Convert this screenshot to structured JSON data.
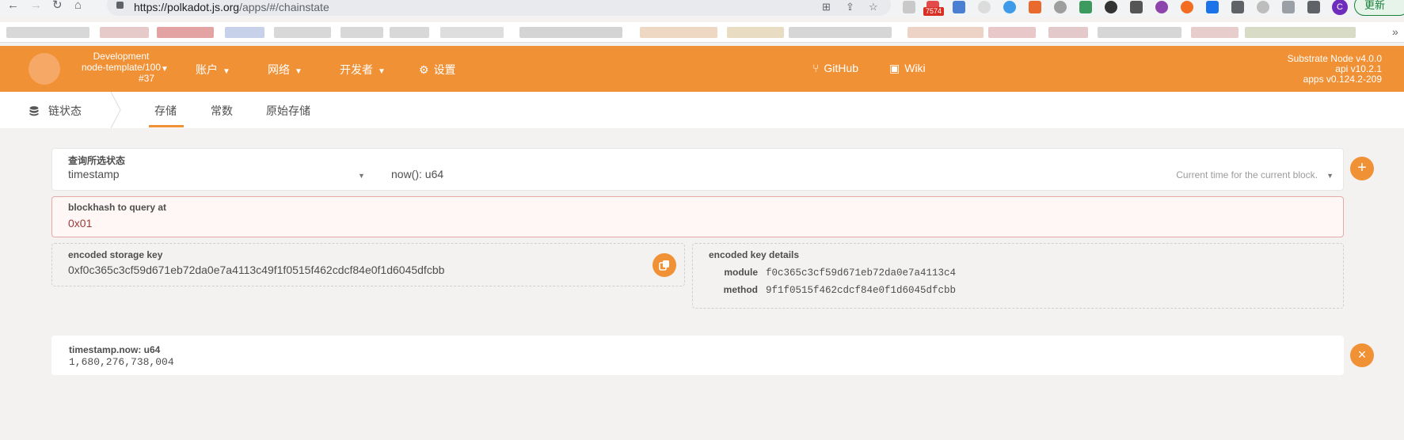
{
  "browser": {
    "url_host": "polkadot.js.org",
    "url_path": "/apps/#/chainstate",
    "mail_badge": "7574",
    "avatar_letter": "C",
    "update_label": "更新"
  },
  "chain": {
    "name": "Development",
    "runtime": "node-template/100",
    "block": "#37"
  },
  "menu": {
    "accounts": "账户",
    "network": "网络",
    "developer": "开发者",
    "settings": "设置"
  },
  "links": {
    "github": "GitHub",
    "wiki": "Wiki"
  },
  "node": {
    "name": "Substrate Node v4.0.0",
    "api": "api v10.2.1",
    "apps": "apps v0.124.2-209"
  },
  "page": {
    "section_title": "链状态",
    "tabs": [
      "存储",
      "常数",
      "原始存储"
    ]
  },
  "query": {
    "label": "查询所选状态",
    "module": "timestamp",
    "method": "now(): u64",
    "method_hint": "Current time for the current block."
  },
  "blockhash": {
    "label": "blockhash to query at",
    "value": "0x01"
  },
  "storage_key": {
    "label": "encoded storage key",
    "value": "0xf0c365c3cf59d671eb72da0e7a4113c49f1f0515f462cdcf84e0f1d6045dfcbb"
  },
  "key_details": {
    "label": "encoded key details",
    "module_label": "module",
    "module_value": "f0c365c3cf59d671eb72da0e7a4113c4",
    "method_label": "method",
    "method_value": "9f1f0515f462cdcf84e0f1d6045dfcbb"
  },
  "result": {
    "label": "timestamp.now: u64",
    "value": "1,680,276,738,004"
  },
  "icons": {
    "add": "+",
    "remove": "×",
    "copy": "copy-icon"
  },
  "colors": {
    "accent": "#f19135",
    "error_text": "#9f3a38",
    "error_bg": "#fff6f6"
  }
}
